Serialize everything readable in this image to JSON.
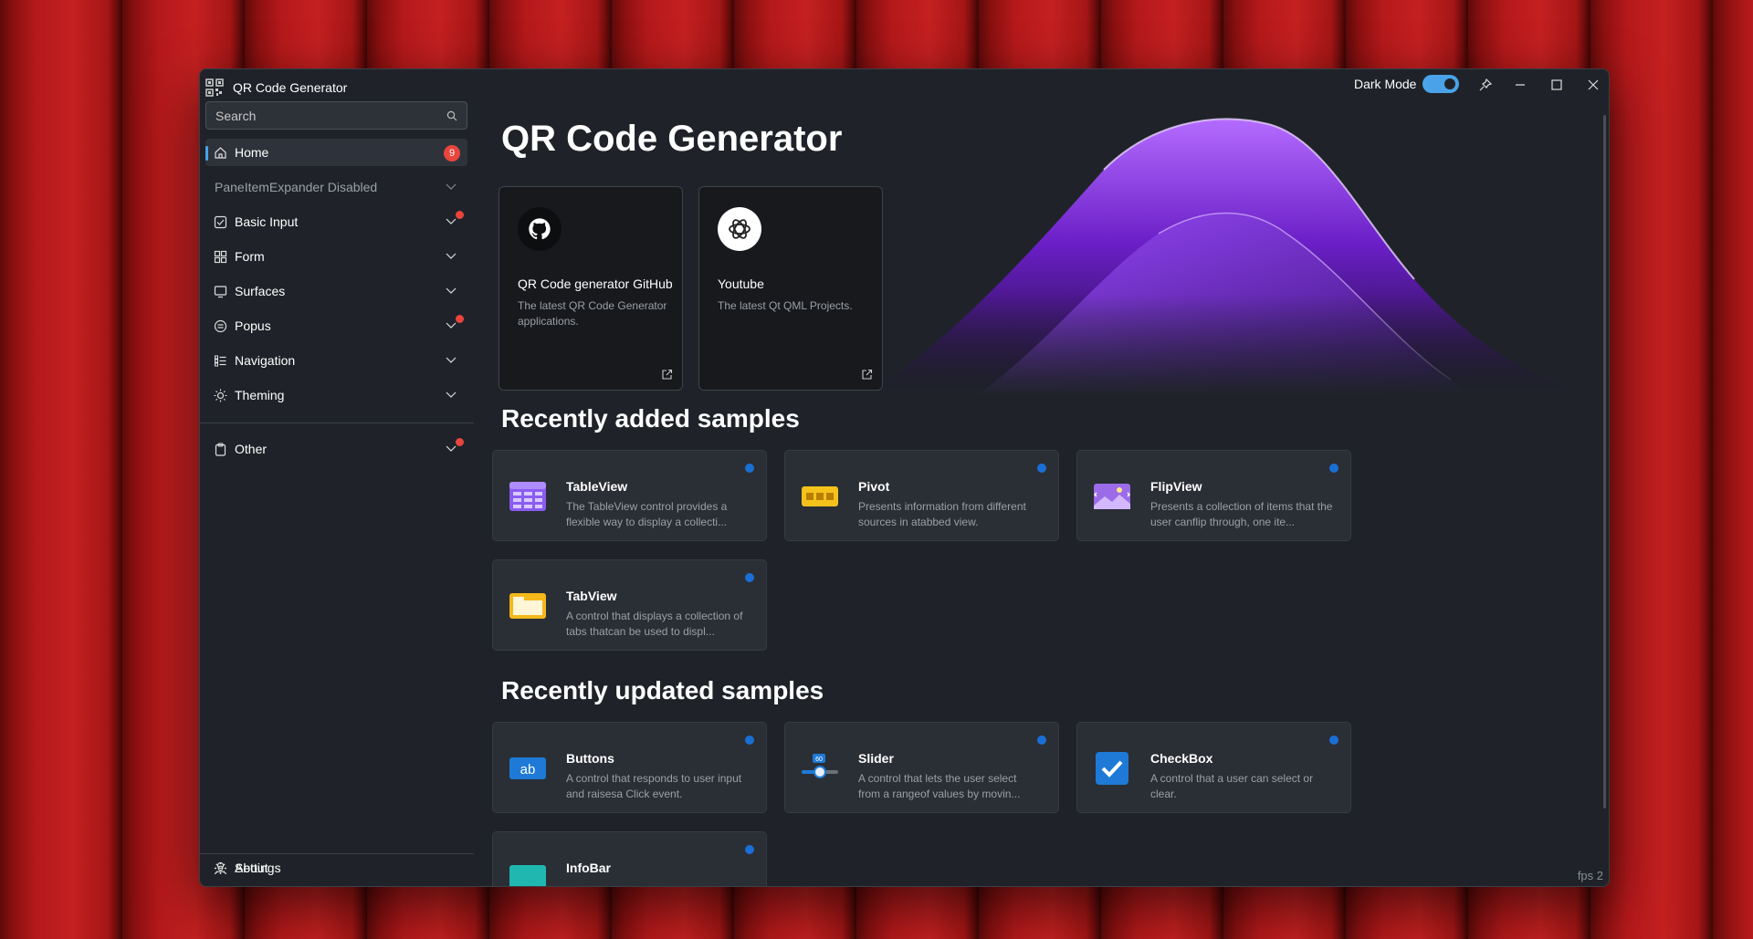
{
  "app": {
    "title": "QR Code Generator"
  },
  "titlebar": {
    "dark_mode_label": "Dark Mode",
    "dark_mode_on": true
  },
  "search": {
    "placeholder": "Search"
  },
  "sidebar": {
    "items": [
      {
        "label": "Home",
        "icon": "home-icon",
        "badge": "9"
      },
      {
        "label": "PaneItemExpander Disabled"
      },
      {
        "label": "Basic Input",
        "icon": "checkbox-icon",
        "dot": true
      },
      {
        "label": "Form",
        "icon": "grid-icon"
      },
      {
        "label": "Surfaces",
        "icon": "surface-icon"
      },
      {
        "label": "Popus",
        "icon": "popup-icon",
        "dot": true
      },
      {
        "label": "Navigation",
        "icon": "navigation-icon"
      },
      {
        "label": "Theming",
        "icon": "sun-icon"
      },
      {
        "label": "Other",
        "icon": "clipboard-icon",
        "dot": true
      }
    ],
    "footer": [
      {
        "label": "About",
        "icon": "person-icon"
      },
      {
        "label": "Settings",
        "icon": "gear-icon"
      }
    ]
  },
  "hero": {
    "title": "QR Code Generator",
    "cards": [
      {
        "title": "QR Code generator GitHub",
        "desc": "The latest QR Code Generator applications.",
        "icon": "github-icon"
      },
      {
        "title": "Youtube",
        "desc": "The latest Qt QML Projects.",
        "icon": "openai-icon"
      }
    ]
  },
  "recently_added": {
    "title": "Recently added samples",
    "items": [
      {
        "title": "TableView",
        "desc": "The TableView control provides a flexible way to display a collecti...",
        "icon": "table-icon"
      },
      {
        "title": "Pivot",
        "desc": "Presents information from different sources in atabbed view.",
        "icon": "pivot-icon"
      },
      {
        "title": "FlipView",
        "desc": "Presents a collection of items that the user canflip through, one ite...",
        "icon": "flipview-icon"
      },
      {
        "title": "TabView",
        "desc": "A control that displays a collection of tabs thatcan be used to displ...",
        "icon": "tabview-icon"
      }
    ]
  },
  "recently_updated": {
    "title": "Recently updated samples",
    "items": [
      {
        "title": "Buttons",
        "desc": "A control that responds to user input and raisesa Click event.",
        "icon": "button-icon"
      },
      {
        "title": "Slider",
        "desc": "A control that lets the user select from a rangeof values by movin...",
        "icon": "slider-icon",
        "icon_text": "60"
      },
      {
        "title": "CheckBox",
        "desc": "A control that a user can select or clear.",
        "icon": "checkbox-icon"
      },
      {
        "title": "InfoBar",
        "desc": "",
        "icon": "infobar-icon"
      }
    ]
  },
  "status": {
    "fps": "fps 2"
  },
  "colors": {
    "accent": "#4aa3e8",
    "badge": "#e8453c",
    "new_dot": "#1a6fd4",
    "purple": "#7b2ff7"
  }
}
